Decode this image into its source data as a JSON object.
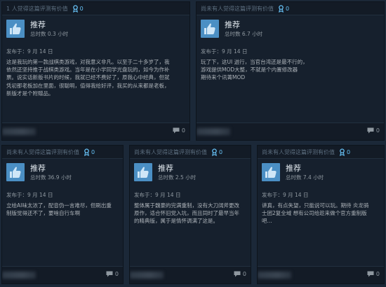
{
  "reviews": [
    {
      "helpful_text": "1 人觉得这篇评测有价值",
      "award_count": "0",
      "recommendation": "推荐",
      "hours": "总时数 0.3 小时",
      "posted": "发布于：9 月 14 日",
      "body": "这是我玩的第一款战棋类游戏，对我意义非凡。以至于二十多岁了，我\n依然还坚持推于战棋类游戏。当年是在小学同学光盘玩的，如今为作补\n票。说实话新版书片的时候，我就已经不费好了，原我心中经典，但就\n凭初那老板加在里面，很聪明，值得我给好评，我买的从来都是老板，\n新版才是个附赠品。",
      "comment_count": "0"
    },
    {
      "helpful_text": "尚未有人觉得这篇评测有价值",
      "award_count": "0",
      "recommendation": "推荐",
      "hours": "总时数 6.7 小时",
      "posted": "发布于：9 月 14 日",
      "body": "玩了下，这UI 迸行，当官台湾还是最不行的，\n游戏提供MOD大整，不就是个内置修改器\n期待来个讯菁MOD",
      "comment_count": "0"
    },
    {
      "helpful_text": "尚未有人觉得这篇评测有价值",
      "award_count": "0",
      "recommendation": "推荐",
      "hours": "总时数 36.9 小时",
      "posted": "发布于：9 月 14 日",
      "body": "立绘AI味太浓了，配音伪一言难尽，但刷出重\n制版觉得还不了，要啥自行车啊",
      "comment_count": "0"
    },
    {
      "helpful_text": "尚未有人觉得这篇评测有价值",
      "award_count": "0",
      "recommendation": "推荐",
      "hours": "总时数 2.5 小时",
      "posted": "发布于：9 月 14 日",
      "body": "整体属于魏豪的完满重制，没有大刀阔斧更改\n原作，适合怀旧党入坑，而且同时了最早当年\n的精典版，属于是情怀调满了这是。",
      "comment_count": "0"
    },
    {
      "helpful_text": "尚未有人觉得这篇评测有价值",
      "award_count": "0",
      "recommendation": "推荐",
      "hours": "总时数 7.4 小时",
      "posted": "发布于：9 月 14 日",
      "body": "讲真，有点失望，只能说可以玩。期待 炎龙骑\n士团2复全域 想有公司给趁来做个官方重制版\n吧...",
      "comment_count": "0"
    }
  ]
}
